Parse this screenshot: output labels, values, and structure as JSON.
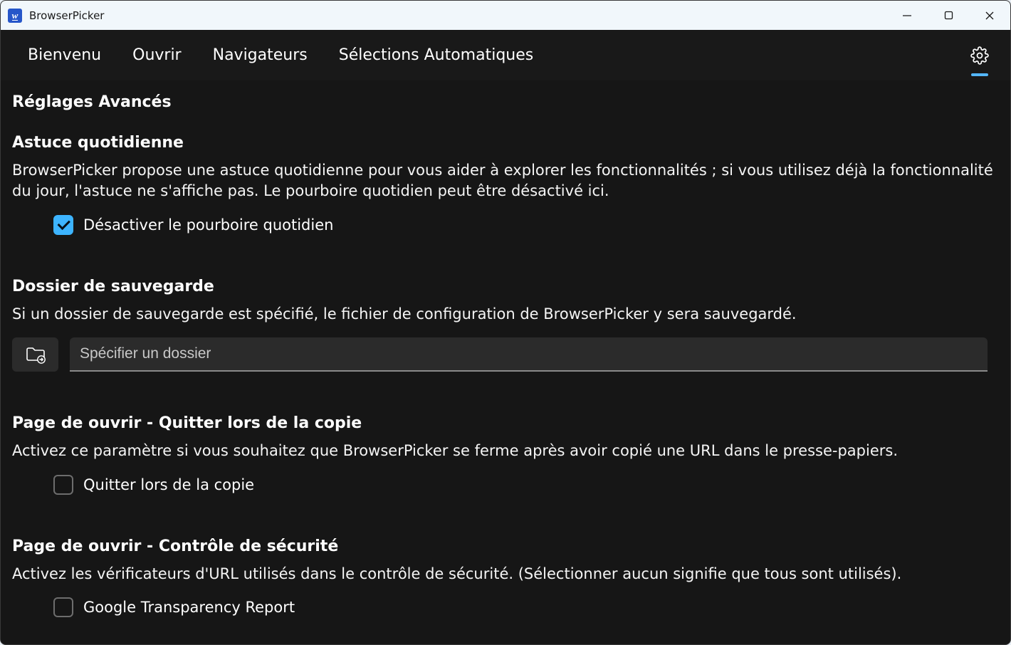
{
  "window": {
    "title": "BrowserPicker"
  },
  "nav": {
    "tabs": [
      "Bienvenu",
      "Ouvrir",
      "Navigateurs",
      "Sélections Automatiques"
    ]
  },
  "page": {
    "title": "Réglages Avancés"
  },
  "sections": {
    "dailyTip": {
      "heading": "Astuce quotidienne",
      "desc": "BrowserPicker propose une astuce quotidienne pour vous aider à explorer les fonctionnalités ; si vous utilisez déjà la fonctionnalité du jour, l'astuce ne s'affiche pas. Le pourboire quotidien peut être désactivé ici.",
      "checkboxLabel": "Désactiver le pourboire quotidien",
      "checked": true
    },
    "backupFolder": {
      "heading": "Dossier de sauvegarde",
      "desc": "Si un dossier de sauvegarde est spécifié, le fichier de configuration de BrowserPicker y sera sauvegardé.",
      "placeholder": "Spécifier un dossier",
      "value": ""
    },
    "quitOnCopy": {
      "heading": "Page de ouvrir - Quitter lors de la copie",
      "desc": "Activez ce paramètre si vous souhaitez que BrowserPicker se ferme après avoir copié une URL dans le presse-papiers.",
      "checkboxLabel": "Quitter lors de la copie",
      "checked": false
    },
    "securityCheck": {
      "heading": "Page de ouvrir - Contrôle de sécurité",
      "desc": "Activez les vérificateurs d'URL utilisés dans le contrôle de sécurité. (Sélectionner aucun signifie que tous sont utilisés).",
      "options": [
        {
          "label": "Google Transparency Report",
          "checked": false
        }
      ]
    }
  }
}
